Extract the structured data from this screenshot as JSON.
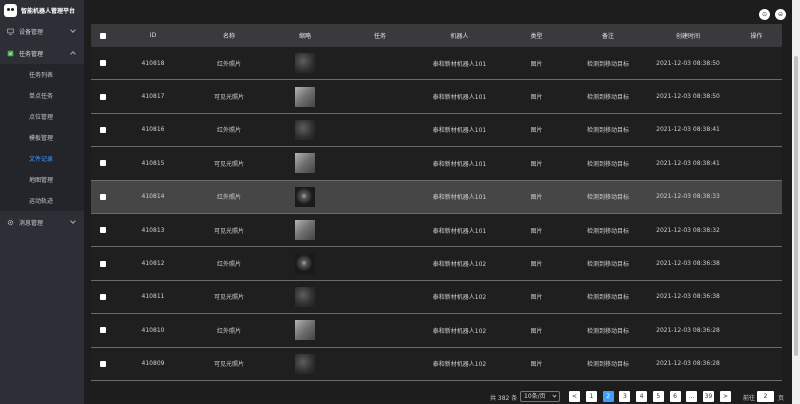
{
  "app": {
    "title": "智能机器人管理平台"
  },
  "sidebar": {
    "groups": [
      {
        "label": "设备管理",
        "icon": "monitor-icon"
      },
      {
        "label": "任务管理",
        "icon": "task-icon"
      },
      {
        "label": "消息管理",
        "icon": "gear-icon"
      }
    ],
    "items": [
      "任务列表",
      "单点任务",
      "点位管理",
      "模板管理",
      "文件记录",
      "地图管理",
      "运动轨迹"
    ],
    "active_item": "文件记录"
  },
  "table": {
    "headers": [
      "ID",
      "名称",
      "缩略",
      "任务",
      "机器人",
      "类型",
      "备注",
      "创建时间",
      "操作"
    ],
    "rows": [
      {
        "id": "410818",
        "name": "红外照片",
        "task": "",
        "robot": "泰和新材机器人101",
        "type": "图片",
        "note": "检测到移动目标",
        "time": "2021-12-03 08:38:50",
        "thumb": "ir"
      },
      {
        "id": "410817",
        "name": "可见光照片",
        "task": "",
        "robot": "泰和新材机器人101",
        "type": "图片",
        "note": "检测到移动目标",
        "time": "2021-12-03 08:38:50",
        "thumb": "vis"
      },
      {
        "id": "410816",
        "name": "红外照片",
        "task": "",
        "robot": "泰和新材机器人101",
        "type": "图片",
        "note": "检测到移动目标",
        "time": "2021-12-03 08:38:41",
        "thumb": "ir"
      },
      {
        "id": "410815",
        "name": "可见光照片",
        "task": "",
        "robot": "泰和新材机器人101",
        "type": "图片",
        "note": "检测到移动目标",
        "time": "2021-12-03 08:38:41",
        "thumb": "vis"
      },
      {
        "id": "410814",
        "name": "红外照片",
        "task": "",
        "robot": "泰和新材机器人101",
        "type": "图片",
        "note": "检测到移动目标",
        "time": "2021-12-03 08:38:33",
        "thumb": "dark"
      },
      {
        "id": "410813",
        "name": "可见光照片",
        "task": "",
        "robot": "泰和新材机器人101",
        "type": "图片",
        "note": "检测到移动目标",
        "time": "2021-12-03 08:38:32",
        "thumb": "vis"
      },
      {
        "id": "410812",
        "name": "红外照片",
        "task": "",
        "robot": "泰和新材机器人102",
        "type": "图片",
        "note": "检测到移动目标",
        "time": "2021-12-03 08:36:38",
        "thumb": "dark"
      },
      {
        "id": "410811",
        "name": "可见光照片",
        "task": "",
        "robot": "泰和新材机器人102",
        "type": "图片",
        "note": "检测到移动目标",
        "time": "2021-12-03 08:36:38",
        "thumb": "ir"
      },
      {
        "id": "410810",
        "name": "红外照片",
        "task": "",
        "robot": "泰和新材机器人102",
        "type": "图片",
        "note": "检测到移动目标",
        "time": "2021-12-03 08:36:28",
        "thumb": "vis"
      },
      {
        "id": "410809",
        "name": "可见光照片",
        "task": "",
        "robot": "泰和新材机器人102",
        "type": "图片",
        "note": "检测到移动目标",
        "time": "2021-12-03 08:36:28",
        "thumb": "ir"
      }
    ],
    "highlight_row": 4
  },
  "pagination": {
    "total": "共 382 条",
    "page_size": "10条/页",
    "pages": [
      "1",
      "2",
      "3",
      "4",
      "5",
      "6",
      "...",
      "39"
    ],
    "current": "2",
    "prev": "<",
    "next": ">",
    "goto_label": "前往",
    "goto_value": "2",
    "goto_unit": "页"
  },
  "top_buttons": [
    "⊙",
    "⊖"
  ],
  "colors": {
    "accent": "#409eff",
    "sidebar": "#2d2f36",
    "header_row": "#3a3a3c"
  }
}
